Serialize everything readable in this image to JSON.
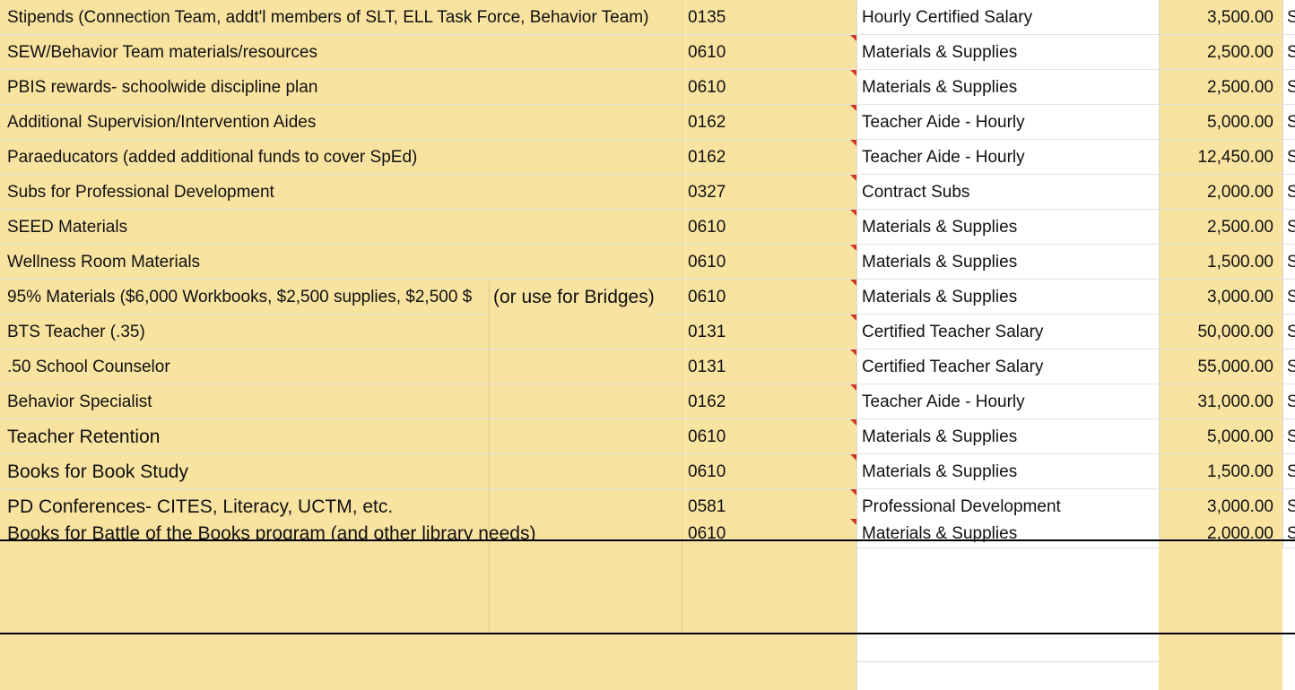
{
  "rows": [
    {
      "desc": "Stipends (Connection Team, addt'l members of SLT, ELL Task Force, Behavior Team)",
      "code": "0135",
      "category": "Hourly Certified Salary",
      "amount": "3,500.00",
      "s": "S"
    },
    {
      "desc": "SEW/Behavior Team materials/resources",
      "code": "0610",
      "category": "Materials & Supplies",
      "amount": "2,500.00",
      "s": "S"
    },
    {
      "desc": "PBIS rewards- schoolwide discipline plan",
      "code": "0610",
      "category": "Materials & Supplies",
      "amount": "2,500.00",
      "s": "S"
    },
    {
      "desc": "Additional Supervision/Intervention Aides",
      "code": "0162",
      "category": "Teacher Aide - Hourly",
      "amount": "5,000.00",
      "s": "S"
    },
    {
      "desc": "Paraeducators (added additional funds to cover SpEd)",
      "code": "0162",
      "category": "Teacher Aide - Hourly",
      "amount": "12,450.00",
      "s": "S"
    },
    {
      "desc": "Subs for Professional Development",
      "code": "0327",
      "category": "Contract Subs",
      "amount": "2,000.00",
      "s": "S"
    },
    {
      "desc": "SEED Materials",
      "code": "0610",
      "category": "Materials & Supplies",
      "amount": "2,500.00",
      "s": "S"
    },
    {
      "desc": "Wellness Room Materials",
      "code": "0610",
      "category": "Materials & Supplies",
      "amount": "1,500.00",
      "s": "S"
    },
    {
      "desc": "95% Materials ($6,000 Workbooks, $2,500 supplies, $2,500 $",
      "desc_extra": "(or use for Bridges)",
      "code": "0610",
      "category": "Materials & Supplies",
      "amount": "3,000.00",
      "s": "S"
    },
    {
      "desc": "BTS Teacher (.35)",
      "code": "0131",
      "category": "Certified Teacher Salary",
      "amount": "50,000.00",
      "s": "S"
    },
    {
      "desc": ".50 School Counselor",
      "code": "0131",
      "category": "Certified Teacher Salary",
      "amount": "55,000.00",
      "s": "S"
    },
    {
      "desc": "Behavior Specialist",
      "code": "0162",
      "category": "Teacher Aide - Hourly",
      "amount": "31,000.00",
      "s": "S"
    },
    {
      "desc": "Teacher Retention",
      "code": "0610",
      "category": "Materials & Supplies",
      "amount": "5,000.00",
      "s": "S"
    },
    {
      "desc": "Books for Book Study",
      "code": "0610",
      "category": "Materials & Supplies",
      "amount": "1,500.00",
      "s": "S"
    },
    {
      "desc": "PD Conferences- CITES, Literacy, UCTM, etc.",
      "code": "0581",
      "category": "Professional Development",
      "amount": "3,000.00",
      "s": "S"
    },
    {
      "desc": "Books for Battle of the Books program (and other library needs)",
      "code": "0610",
      "category": "Materials & Supplies",
      "amount": "2,000.00",
      "s": "S"
    }
  ],
  "colors": {
    "cell_fill": "#f9e3a0",
    "comment_flag": "#d0391f",
    "gridline": "#e2e2e2"
  }
}
